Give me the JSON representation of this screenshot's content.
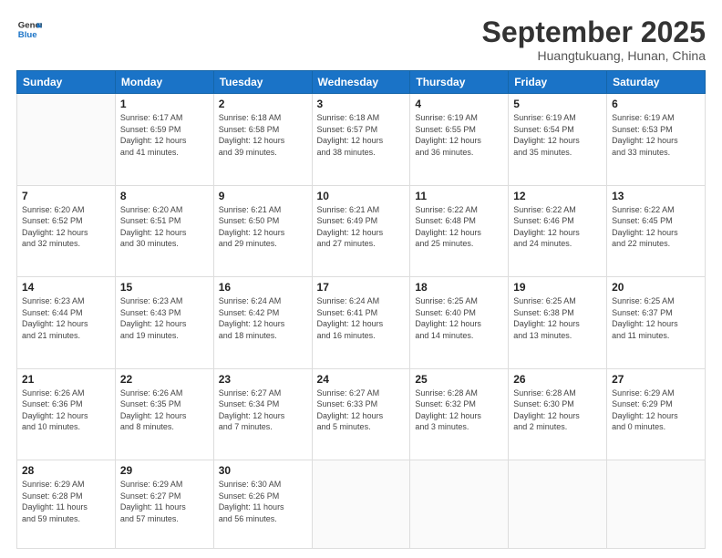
{
  "logo": {
    "line1": "General",
    "line2": "Blue"
  },
  "title": "September 2025",
  "subtitle": "Huangtukuang, Hunan, China",
  "days_header": [
    "Sunday",
    "Monday",
    "Tuesday",
    "Wednesday",
    "Thursday",
    "Friday",
    "Saturday"
  ],
  "weeks": [
    [
      {
        "day": "",
        "info": ""
      },
      {
        "day": "1",
        "info": "Sunrise: 6:17 AM\nSunset: 6:59 PM\nDaylight: 12 hours\nand 41 minutes."
      },
      {
        "day": "2",
        "info": "Sunrise: 6:18 AM\nSunset: 6:58 PM\nDaylight: 12 hours\nand 39 minutes."
      },
      {
        "day": "3",
        "info": "Sunrise: 6:18 AM\nSunset: 6:57 PM\nDaylight: 12 hours\nand 38 minutes."
      },
      {
        "day": "4",
        "info": "Sunrise: 6:19 AM\nSunset: 6:55 PM\nDaylight: 12 hours\nand 36 minutes."
      },
      {
        "day": "5",
        "info": "Sunrise: 6:19 AM\nSunset: 6:54 PM\nDaylight: 12 hours\nand 35 minutes."
      },
      {
        "day": "6",
        "info": "Sunrise: 6:19 AM\nSunset: 6:53 PM\nDaylight: 12 hours\nand 33 minutes."
      }
    ],
    [
      {
        "day": "7",
        "info": "Sunrise: 6:20 AM\nSunset: 6:52 PM\nDaylight: 12 hours\nand 32 minutes."
      },
      {
        "day": "8",
        "info": "Sunrise: 6:20 AM\nSunset: 6:51 PM\nDaylight: 12 hours\nand 30 minutes."
      },
      {
        "day": "9",
        "info": "Sunrise: 6:21 AM\nSunset: 6:50 PM\nDaylight: 12 hours\nand 29 minutes."
      },
      {
        "day": "10",
        "info": "Sunrise: 6:21 AM\nSunset: 6:49 PM\nDaylight: 12 hours\nand 27 minutes."
      },
      {
        "day": "11",
        "info": "Sunrise: 6:22 AM\nSunset: 6:48 PM\nDaylight: 12 hours\nand 25 minutes."
      },
      {
        "day": "12",
        "info": "Sunrise: 6:22 AM\nSunset: 6:46 PM\nDaylight: 12 hours\nand 24 minutes."
      },
      {
        "day": "13",
        "info": "Sunrise: 6:22 AM\nSunset: 6:45 PM\nDaylight: 12 hours\nand 22 minutes."
      }
    ],
    [
      {
        "day": "14",
        "info": "Sunrise: 6:23 AM\nSunset: 6:44 PM\nDaylight: 12 hours\nand 21 minutes."
      },
      {
        "day": "15",
        "info": "Sunrise: 6:23 AM\nSunset: 6:43 PM\nDaylight: 12 hours\nand 19 minutes."
      },
      {
        "day": "16",
        "info": "Sunrise: 6:24 AM\nSunset: 6:42 PM\nDaylight: 12 hours\nand 18 minutes."
      },
      {
        "day": "17",
        "info": "Sunrise: 6:24 AM\nSunset: 6:41 PM\nDaylight: 12 hours\nand 16 minutes."
      },
      {
        "day": "18",
        "info": "Sunrise: 6:25 AM\nSunset: 6:40 PM\nDaylight: 12 hours\nand 14 minutes."
      },
      {
        "day": "19",
        "info": "Sunrise: 6:25 AM\nSunset: 6:38 PM\nDaylight: 12 hours\nand 13 minutes."
      },
      {
        "day": "20",
        "info": "Sunrise: 6:25 AM\nSunset: 6:37 PM\nDaylight: 12 hours\nand 11 minutes."
      }
    ],
    [
      {
        "day": "21",
        "info": "Sunrise: 6:26 AM\nSunset: 6:36 PM\nDaylight: 12 hours\nand 10 minutes."
      },
      {
        "day": "22",
        "info": "Sunrise: 6:26 AM\nSunset: 6:35 PM\nDaylight: 12 hours\nand 8 minutes."
      },
      {
        "day": "23",
        "info": "Sunrise: 6:27 AM\nSunset: 6:34 PM\nDaylight: 12 hours\nand 7 minutes."
      },
      {
        "day": "24",
        "info": "Sunrise: 6:27 AM\nSunset: 6:33 PM\nDaylight: 12 hours\nand 5 minutes."
      },
      {
        "day": "25",
        "info": "Sunrise: 6:28 AM\nSunset: 6:32 PM\nDaylight: 12 hours\nand 3 minutes."
      },
      {
        "day": "26",
        "info": "Sunrise: 6:28 AM\nSunset: 6:30 PM\nDaylight: 12 hours\nand 2 minutes."
      },
      {
        "day": "27",
        "info": "Sunrise: 6:29 AM\nSunset: 6:29 PM\nDaylight: 12 hours\nand 0 minutes."
      }
    ],
    [
      {
        "day": "28",
        "info": "Sunrise: 6:29 AM\nSunset: 6:28 PM\nDaylight: 11 hours\nand 59 minutes."
      },
      {
        "day": "29",
        "info": "Sunrise: 6:29 AM\nSunset: 6:27 PM\nDaylight: 11 hours\nand 57 minutes."
      },
      {
        "day": "30",
        "info": "Sunrise: 6:30 AM\nSunset: 6:26 PM\nDaylight: 11 hours\nand 56 minutes."
      },
      {
        "day": "",
        "info": ""
      },
      {
        "day": "",
        "info": ""
      },
      {
        "day": "",
        "info": ""
      },
      {
        "day": "",
        "info": ""
      }
    ]
  ]
}
